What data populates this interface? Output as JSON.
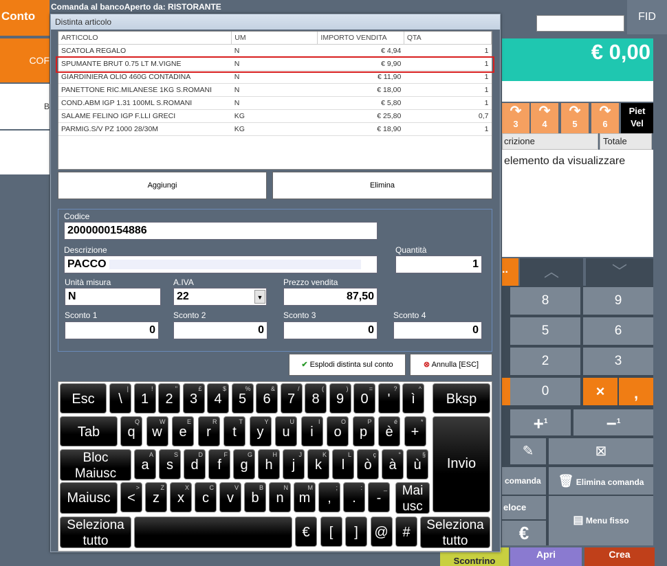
{
  "app": {
    "title": "Comanda al bancoAperto da: RISTORANTE",
    "conto_tab": "Conto",
    "co_tab": "COF",
    "b_label": "B",
    "fid": "FID",
    "total": "€ 0,00",
    "nav_buttons": [
      "3",
      "4",
      "5",
      "6"
    ],
    "piet_line1": "Piet",
    "piet_line2": "Vel",
    "table_header_desc": "crizione",
    "table_header_total": "Totale",
    "empty_message": "elemento da visualizzare",
    "orange_left_label": "..",
    "numpad": [
      "8",
      "9",
      "5",
      "6",
      "2",
      "3",
      "0"
    ],
    "times_label": "×",
    "comma_label": ",",
    "plus_label": "+",
    "plus_sup": "1",
    "minus_label": "−",
    "minus_sup": "1",
    "comanda_label": "comanda",
    "elimina_comanda": "Elimina comanda",
    "veloce_label": "eloce",
    "menu_fisso": "Menu fisso",
    "euro_label": "€",
    "scontrino": "Scontrino",
    "apri": "Apri",
    "crea": "Crea"
  },
  "dialog": {
    "title": "Distinta articolo",
    "columns": [
      "ARTICOLO",
      "UM",
      "IMPORTO VENDITA",
      "QTA"
    ],
    "rows": [
      {
        "articolo": "SCATOLA REGALO",
        "um": "N",
        "importo": "€ 4,94",
        "qta": "1"
      },
      {
        "articolo": "SPUMANTE BRUT 0.75 LT M.VIGNE",
        "um": "N",
        "importo": "€ 9,90",
        "qta": "1"
      },
      {
        "articolo": "GIARDINIERA OLIO 460G CONTADINA",
        "um": "N",
        "importo": "€ 11,90",
        "qta": "1"
      },
      {
        "articolo": "PANETTONE RIC.MILANESE 1KG S.ROMANI",
        "um": "N",
        "importo": "€ 18,00",
        "qta": "1"
      },
      {
        "articolo": "COND.ABM IGP 1.31 100ML S.ROMANI",
        "um": "N",
        "importo": "€ 5,80",
        "qta": "1"
      },
      {
        "articolo": "SALAME FELINO IGP F.LLI GRECI",
        "um": "KG",
        "importo": "€ 25,80",
        "qta": "0,7"
      },
      {
        "articolo": "PARMIG.S/V PZ 1000 28/30M",
        "um": "KG",
        "importo": "€ 18,90",
        "qta": "1"
      }
    ],
    "aggiungi": "Aggiungi",
    "elimina": "Elimina",
    "fields": {
      "codice_label": "Codice",
      "codice_value": "2000000154886",
      "descrizione_label": "Descrizione",
      "descrizione_value": "PACCO",
      "quantita_label": "Quantità",
      "quantita_value": "1",
      "um_label": "Unità misura",
      "um_value": "N",
      "iva_label": "A.IVA",
      "iva_value": "22",
      "prezzo_label": "Prezzo vendita",
      "prezzo_value": "87,50",
      "sconto1_label": "Sconto 1",
      "sconto1_value": "0",
      "sconto2_label": "Sconto 2",
      "sconto2_value": "0",
      "sconto3_label": "Sconto 3",
      "sconto3_value": "0",
      "sconto4_label": "Sconto 4",
      "sconto4_value": "0"
    },
    "esplodi": "Esplodi distinta sul conto",
    "annulla": "Annulla [ESC]"
  },
  "keyboard": {
    "esc": "Esc",
    "row1": [
      [
        "\\",
        "|"
      ],
      [
        "1",
        "!"
      ],
      [
        "2",
        "\""
      ],
      [
        "3",
        "£"
      ],
      [
        "4",
        "$"
      ],
      [
        "5",
        "%"
      ],
      [
        "6",
        "&"
      ],
      [
        "7",
        "/"
      ],
      [
        "8",
        "("
      ],
      [
        "9",
        ")"
      ],
      [
        "0",
        "="
      ],
      [
        "'",
        "?"
      ],
      [
        "ì",
        "^"
      ]
    ],
    "bksp": "Bksp",
    "tab": "Tab",
    "row2": [
      [
        "q",
        "Q"
      ],
      [
        "w",
        "W"
      ],
      [
        "e",
        "E"
      ],
      [
        "r",
        "R"
      ],
      [
        "t",
        "T"
      ],
      [
        "y",
        "Y"
      ],
      [
        "u",
        "U"
      ],
      [
        "i",
        "I"
      ],
      [
        "o",
        "O"
      ],
      [
        "p",
        "P"
      ],
      [
        "è",
        "é"
      ],
      [
        "+",
        "*"
      ]
    ],
    "bloc1": "Bloc",
    "bloc2": "Maiusc",
    "row3": [
      [
        "a",
        "A"
      ],
      [
        "s",
        "S"
      ],
      [
        "d",
        "D"
      ],
      [
        "f",
        "F"
      ],
      [
        "g",
        "G"
      ],
      [
        "h",
        "H"
      ],
      [
        "j",
        "J"
      ],
      [
        "k",
        "K"
      ],
      [
        "l",
        "L"
      ],
      [
        "ò",
        "ç"
      ],
      [
        "à",
        "°"
      ],
      [
        "ù",
        "§"
      ]
    ],
    "invio": "Invio",
    "maiusc": "Maiusc",
    "row4": [
      [
        "<",
        ">"
      ],
      [
        "z",
        "Z"
      ],
      [
        "x",
        "X"
      ],
      [
        "c",
        "C"
      ],
      [
        "v",
        "V"
      ],
      [
        "b",
        "B"
      ],
      [
        "n",
        "N"
      ],
      [
        "m",
        "M"
      ],
      [
        ",",
        ";"
      ],
      [
        ".",
        ":"
      ],
      [
        "-",
        "_"
      ]
    ],
    "maiusc2_1": "Mai",
    "maiusc2_2": "usc",
    "sel1": "Seleziona",
    "sel2": "tutto",
    "row5": [
      "€",
      "[",
      "]",
      "@",
      "#"
    ]
  },
  "colors": {
    "accent": "#f07d14",
    "total_bg": "#1fc7b0",
    "selection_outline": "#d81e1e"
  }
}
